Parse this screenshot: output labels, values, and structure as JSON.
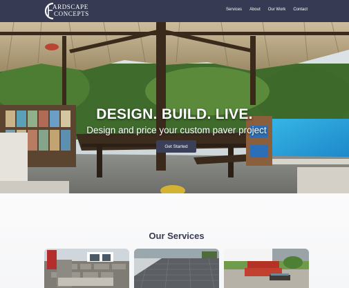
{
  "brand": {
    "logo_line1": "ARDSCAPE",
    "logo_line2": "CONCEPTS",
    "logo_mark": "H"
  },
  "nav": {
    "items": [
      {
        "label": "Services"
      },
      {
        "label": "About"
      },
      {
        "label": "Our Work"
      },
      {
        "label": "Contact"
      }
    ]
  },
  "hero": {
    "title": "DESIGN. BUILD. LIVE.",
    "subtitle": "Design and price your custom paver project",
    "cta_label": "Get Started",
    "image_icon": "gazebo-pool-photo"
  },
  "services": {
    "heading": "Our Services",
    "cards": [
      {
        "icon": "stone-wall-photo"
      },
      {
        "icon": "paver-driveway-photo"
      },
      {
        "icon": "patio-furniture-photo"
      }
    ]
  },
  "colors": {
    "navbar": "#363a52",
    "cta": "#3b3f57",
    "heading": "#363a52"
  }
}
